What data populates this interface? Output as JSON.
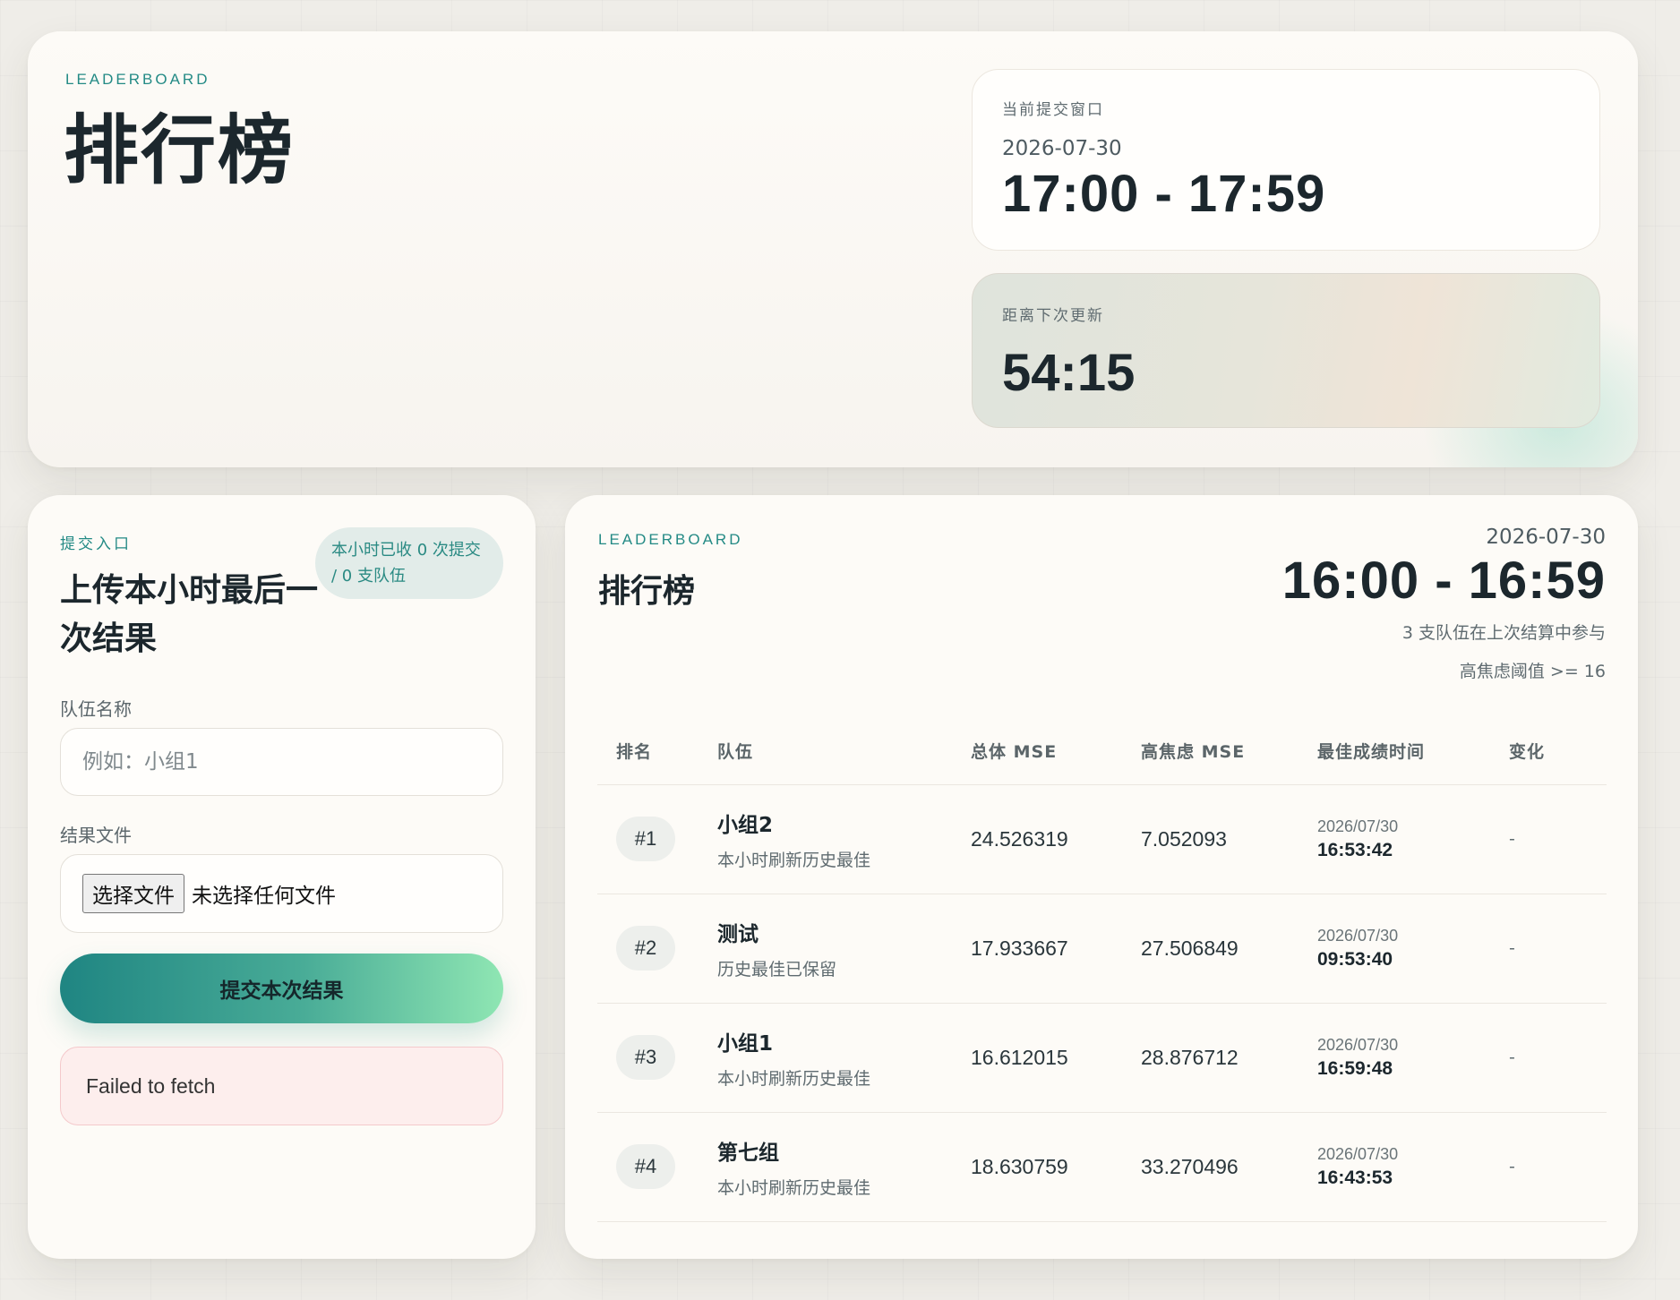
{
  "hero": {
    "eyebrow": "LEADERBOARD",
    "title": "排行榜",
    "current_window": {
      "label": "当前提交窗口",
      "date": "2026-07-30",
      "range": "17:00 - 17:59"
    },
    "countdown": {
      "label": "距离下次更新",
      "value": "54:15"
    }
  },
  "submit": {
    "eyebrow": "提交入口",
    "title": "上传本小时最后一次结果",
    "badge": "本小时已收 0 次提交 / 0 支队伍",
    "team_label": "队伍名称",
    "team_placeholder": "例如：小组1",
    "team_value": "",
    "file_label": "结果文件",
    "file_button": "选择文件",
    "file_status": "未选择任何文件",
    "submit_label": "提交本次结果",
    "error": "Failed to fetch"
  },
  "board": {
    "eyebrow": "LEADERBOARD",
    "title": "排行榜",
    "date": "2026-07-30",
    "range": "16:00 - 16:59",
    "participants": "3 支队伍在上次结算中参与",
    "threshold": "高焦虑阈值 >= 16",
    "columns": [
      "排名",
      "队伍",
      "总体 MSE",
      "高焦虑 MSE",
      "最佳成绩时间",
      "变化"
    ],
    "rows": [
      {
        "rank": "#1",
        "team": "小组2",
        "note": "本小时刷新历史最佳",
        "total_mse": "24.526319",
        "high_mse": "7.052093",
        "best_date": "2026/07/30",
        "best_time": "16:53:42",
        "change": "-"
      },
      {
        "rank": "#2",
        "team": "测试",
        "note": "历史最佳已保留",
        "total_mse": "17.933667",
        "high_mse": "27.506849",
        "best_date": "2026/07/30",
        "best_time": "09:53:40",
        "change": "-"
      },
      {
        "rank": "#3",
        "team": "小组1",
        "note": "本小时刷新历史最佳",
        "total_mse": "16.612015",
        "high_mse": "28.876712",
        "best_date": "2026/07/30",
        "best_time": "16:59:48",
        "change": "-"
      },
      {
        "rank": "#4",
        "team": "第七组",
        "note": "本小时刷新历史最佳",
        "total_mse": "18.630759",
        "high_mse": "33.270496",
        "best_date": "2026/07/30",
        "best_time": "16:43:53",
        "change": "-"
      }
    ]
  }
}
